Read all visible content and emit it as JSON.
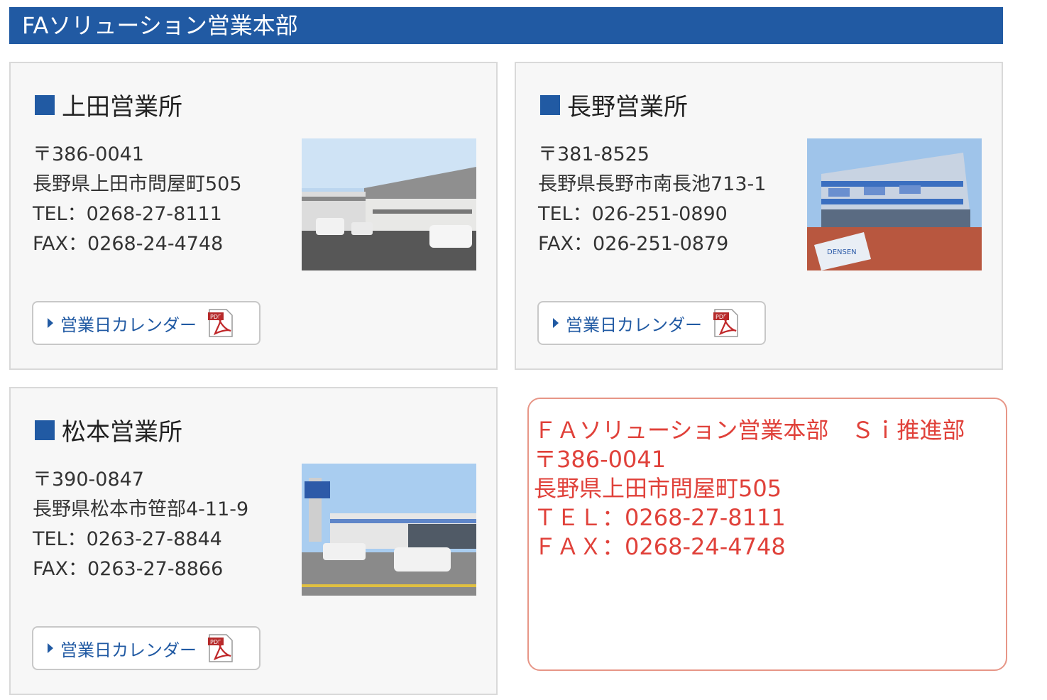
{
  "header": {
    "title": "FAソリューション営業本部"
  },
  "offices": [
    {
      "name": "上田営業所",
      "postal": "〒386-0041",
      "address": "長野県上田市問屋町505",
      "tel": "TEL：0268-27-8111",
      "fax": "FAX：0268-24-4748",
      "calendar_label": "営業日カレンダー",
      "pdf_icon": "pdf-icon"
    },
    {
      "name": "長野営業所",
      "postal": "〒381-8525",
      "address": "長野県長野市南長池713-1",
      "tel": "TEL：026-251-0890",
      "fax": "FAX：026-251-0879",
      "calendar_label": "営業日カレンダー",
      "pdf_icon": "pdf-icon"
    },
    {
      "name": "松本営業所",
      "postal": "〒390-0847",
      "address": "長野県松本市笹部4-11-9",
      "tel": "TEL：0263-27-8844",
      "fax": "FAX：0263-27-8866",
      "calendar_label": "営業日カレンダー",
      "pdf_icon": "pdf-icon"
    }
  ],
  "si_box": {
    "line1": "ＦＡソリューション営業本部　Ｓｉ推進部",
    "line2": "〒386-0041",
    "line3": "長野県上田市問屋町505",
    "line4": "ＴＥＬ：0268-27-8111",
    "line5": "ＦＡＸ：0268-24-4748"
  },
  "colors": {
    "brand": "#215aa3",
    "accent_red": "#e0413a",
    "border_red": "#e79687"
  }
}
